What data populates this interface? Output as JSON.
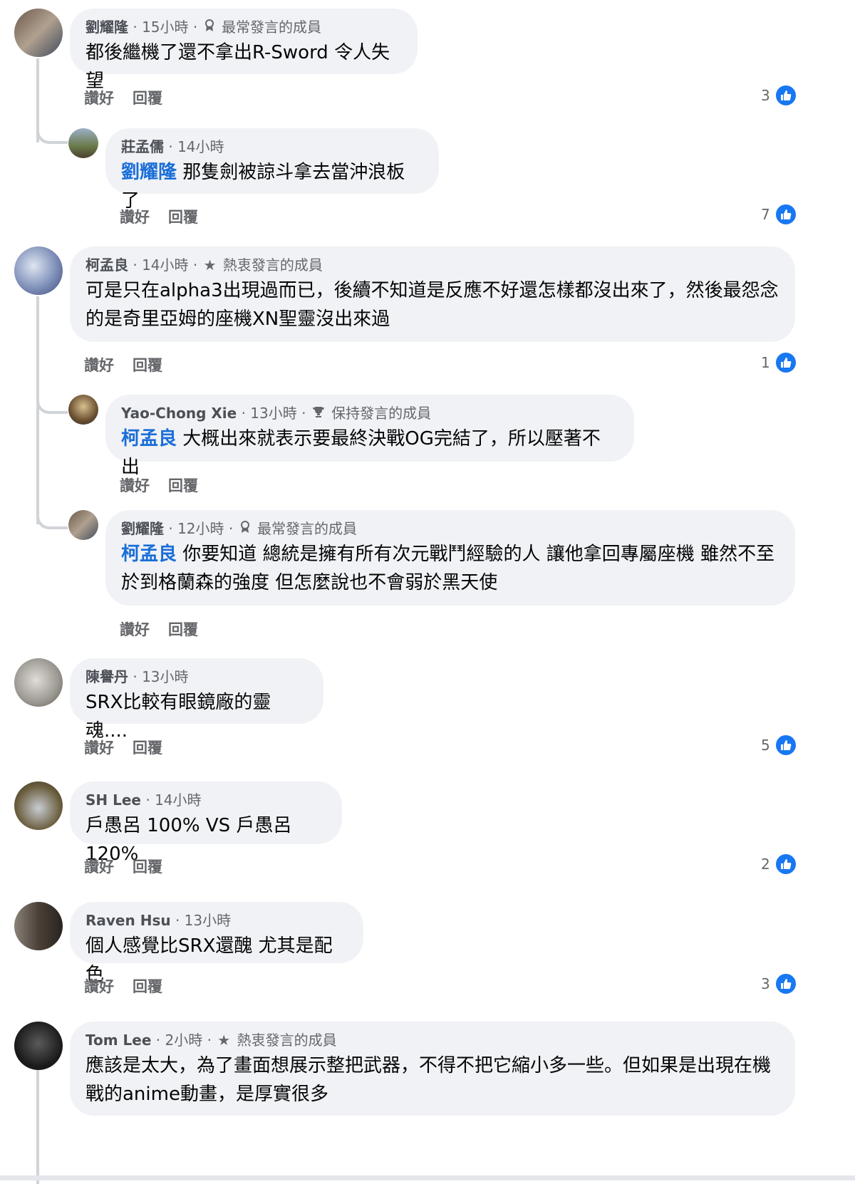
{
  "comments": [
    {
      "id": "c1",
      "name": "劉耀隆",
      "time": "15小時",
      "badge": "最常發言的成員",
      "badge_icon": "ribbon-icon",
      "text": "都後繼機了還不拿出R-Sword 令人失望",
      "mention": "",
      "likes": "3",
      "like_label": "讚好",
      "reply_label": "回覆"
    },
    {
      "id": "r1",
      "name": "莊孟儒",
      "time": "14小時",
      "badge": "",
      "badge_icon": "",
      "text": "那隻劍被諒斗拿去當沖浪板了",
      "mention": "劉耀隆",
      "likes": "7",
      "like_label": "讚好",
      "reply_label": "回覆"
    },
    {
      "id": "c2",
      "name": "柯孟良",
      "time": "14小時",
      "badge": "熱衷發言的成員",
      "badge_icon": "star-icon",
      "text": "可是只在alpha3出現過而已，後續不知道是反應不好還怎樣都沒出來了，然後最怨念的是奇里亞姆的座機XN聖靈沒出來過",
      "mention": "",
      "likes": "1",
      "like_label": "讚好",
      "reply_label": "回覆"
    },
    {
      "id": "r2",
      "name": "Yao-Chong Xie",
      "time": "13小時",
      "badge": "保持發言的成員",
      "badge_icon": "trophy-icon",
      "text": "大概出來就表示要最終決戰OG完結了，所以壓著不出",
      "mention": "柯孟良",
      "likes": "",
      "like_label": "讚好",
      "reply_label": "回覆"
    },
    {
      "id": "r3",
      "name": "劉耀隆",
      "time": "12小時",
      "badge": "最常發言的成員",
      "badge_icon": "ribbon-icon",
      "text": "你要知道 總統是擁有所有次元戰鬥經驗的人 讓他拿回專屬座機 雖然不至於到格蘭森的強度 但怎麼說也不會弱於黑天使",
      "mention": "柯孟良",
      "likes": "",
      "like_label": "讚好",
      "reply_label": "回覆"
    },
    {
      "id": "c3",
      "name": "陳譽丹",
      "time": "13小時",
      "badge": "",
      "badge_icon": "",
      "text": "SRX比較有眼鏡廠的靈魂....",
      "mention": "",
      "likes": "5",
      "like_label": "讚好",
      "reply_label": "回覆"
    },
    {
      "id": "c4",
      "name": "SH Lee",
      "time": "14小時",
      "badge": "",
      "badge_icon": "",
      "text": "戶愚呂 100% VS 戶愚呂120%",
      "mention": "",
      "likes": "2",
      "like_label": "讚好",
      "reply_label": "回覆"
    },
    {
      "id": "c5",
      "name": "Raven Hsu",
      "time": "13小時",
      "badge": "",
      "badge_icon": "",
      "text": "個人感覺比SRX還醜 尤其是配色",
      "mention": "",
      "likes": "3",
      "like_label": "讚好",
      "reply_label": "回覆"
    },
    {
      "id": "c6",
      "name": "Tom Lee",
      "time": "2小時",
      "badge": "熱衷發言的成員",
      "badge_icon": "star-icon",
      "text": "應該是太大，為了畫面想展示整把武器，不得不把它縮小多一些。但如果是出現在機戰的anime動畫，是厚實很多",
      "mention": "",
      "likes": "",
      "like_label": "讚好",
      "reply_label": "回覆"
    }
  ],
  "separator": "·",
  "colors": {
    "bubble": "#f0f2f5",
    "mention": "#1a6ed8",
    "like_blue": "#1877f2",
    "meta": "#65676b"
  }
}
